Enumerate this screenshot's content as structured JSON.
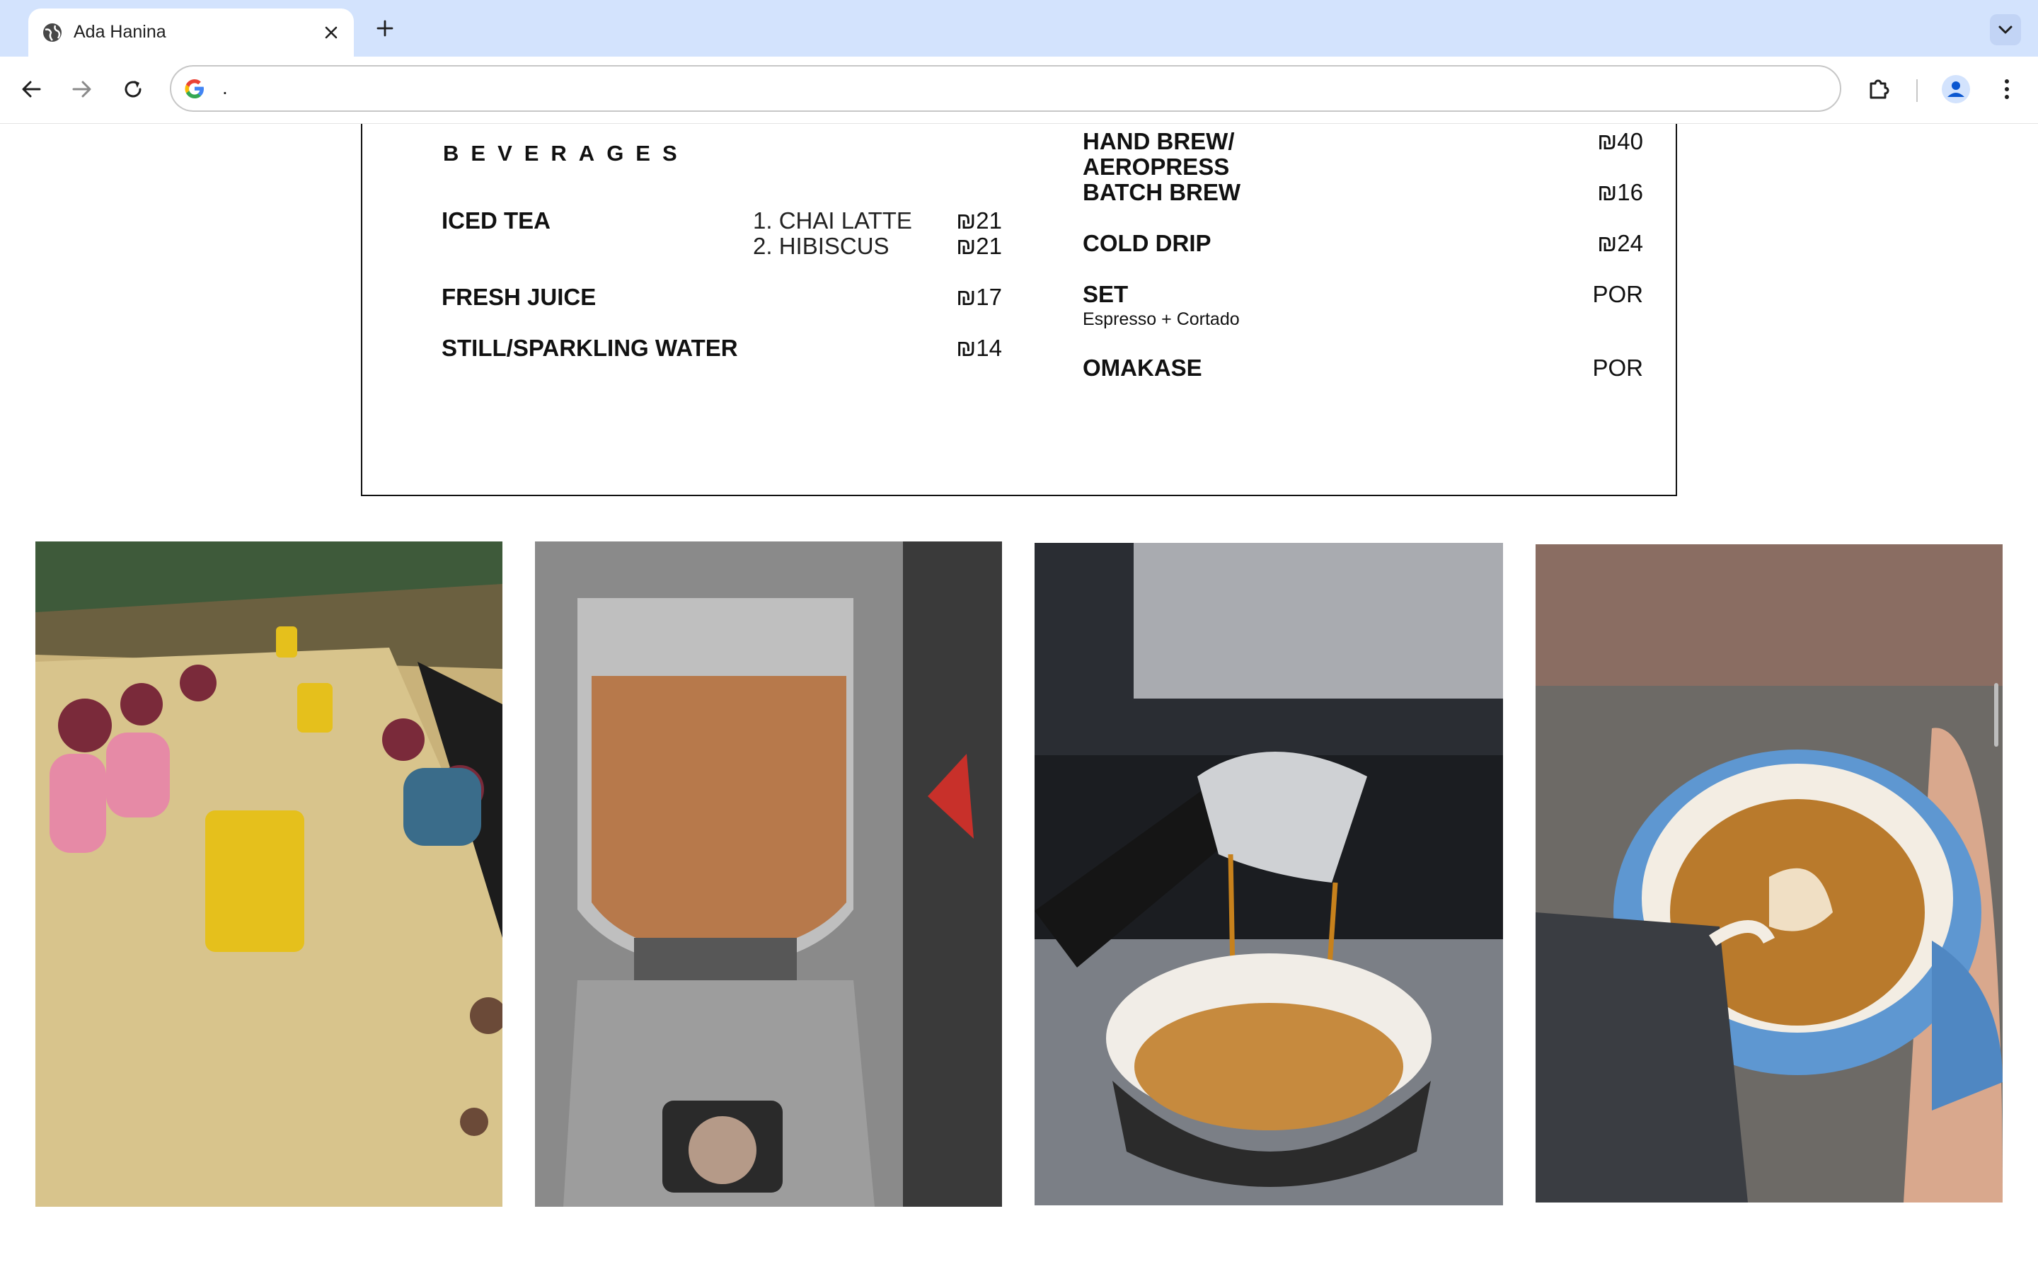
{
  "browser": {
    "tab_title": "Ada Hanina",
    "address": "."
  },
  "menu": {
    "section_title": "BEVERAGES",
    "left_items": [
      {
        "name": "ICED TEA",
        "variants": [
          {
            "label": "1. CHAI LATTE",
            "price": "₪21"
          },
          {
            "label": "2. HIBISCUS",
            "price": "₪21"
          }
        ]
      },
      {
        "name": "FRESH JUICE",
        "price": "₪17"
      },
      {
        "name": "STILL/SPARKLING WATER",
        "price": "₪14"
      }
    ],
    "right_items": [
      {
        "name_line1": "HAND BREW/",
        "name_line2": "AEROPRESS",
        "price": "₪40"
      },
      {
        "name": "BATCH BREW",
        "price": "₪16"
      },
      {
        "name": "COLD DRIP",
        "price": "₪24"
      },
      {
        "name": "SET",
        "subtitle": "Espresso + Cortado",
        "price": "POR"
      },
      {
        "name": "OMAKASE",
        "price": "POR"
      }
    ]
  },
  "photos": [
    {
      "name": "coffee-farm-workers-photo"
    },
    {
      "name": "coffee-grinder-photo"
    },
    {
      "name": "espresso-extraction-photo"
    },
    {
      "name": "latte-art-pour-photo"
    }
  ],
  "colors": {
    "tabbar": "#d3e3fd",
    "border": "#111111",
    "text": "#111111"
  }
}
